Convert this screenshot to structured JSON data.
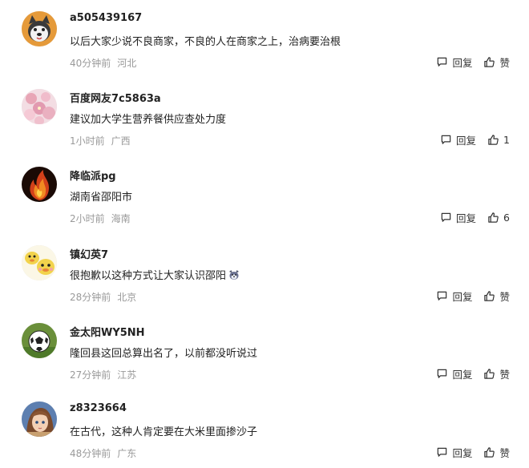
{
  "comments": [
    {
      "username": "a505439167",
      "content": "以后大家少说不良商家，不良的人在商家之上，治病要治根",
      "time": "40分钟前",
      "location": "河北",
      "reply_label": "回复",
      "like_label": "赞",
      "avatar": "husky-avatar"
    },
    {
      "username": "百度网友7c5863a",
      "content": "建议加大学生营养餐供应查处力度",
      "time": "1小时前",
      "location": "广西",
      "reply_label": "回复",
      "like_label": "1",
      "avatar": "pink-flowers-avatar"
    },
    {
      "username": "降临派pg",
      "content": "湖南省邵阳市",
      "time": "2小时前",
      "location": "海南",
      "reply_label": "回复",
      "like_label": "6",
      "avatar": "fire-avatar"
    },
    {
      "username": "镇幻英7",
      "content": "很抱歉以这种方式让大家认识邵阳",
      "time": "28分钟前",
      "location": "北京",
      "reply_label": "回复",
      "like_label": "赞",
      "avatar": "cartoon-ducks-avatar",
      "emoji": "dog-face-emoji"
    },
    {
      "username": "金太阳WY5NH",
      "content": "隆回县这回总算出名了，以前都没听说过",
      "time": "27分钟前",
      "location": "江苏",
      "reply_label": "回复",
      "like_label": "赞",
      "avatar": "soccer-ball-avatar"
    },
    {
      "username": "z8323664",
      "content": "在古代，这种人肯定要在大米里面掺沙子",
      "time": "48分钟前",
      "location": "广东",
      "reply_label": "回复",
      "like_label": "赞",
      "avatar": "anime-girl-avatar"
    }
  ],
  "colors": {
    "meta_text": "#9a9a9a",
    "username": "#222222",
    "content": "#222222"
  },
  "icons": {
    "reply": "speech-bubble-icon",
    "like": "thumbs-up-icon"
  }
}
